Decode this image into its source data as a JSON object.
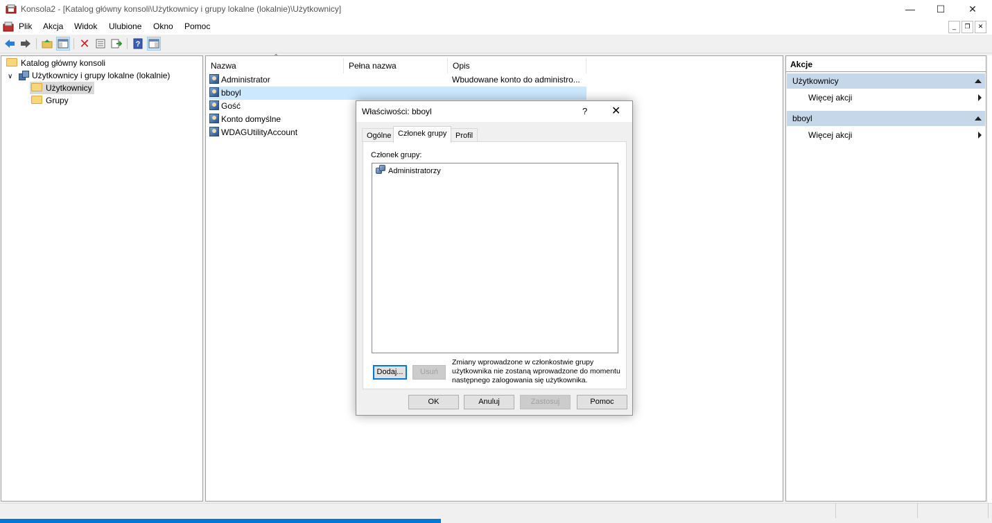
{
  "window": {
    "title": "Konsola2 - [Katalog główny konsoli\\Użytkownicy i grupy lokalne (lokalnie)\\Użytkownicy]"
  },
  "menubar": {
    "items": [
      "Plik",
      "Akcja",
      "Widok",
      "Ulubione",
      "Okno",
      "Pomoc"
    ]
  },
  "toolbar": {
    "icons": [
      "back-arrow-icon",
      "forward-arrow-icon",
      "up-folder-icon",
      "show-hide-console-tree-icon",
      "delete-icon",
      "properties-icon",
      "export-list-icon",
      "help-icon",
      "show-hide-action-pane-icon"
    ]
  },
  "tree": {
    "root": "Katalog główny konsoli",
    "node": "Użytkownicy i grupy lokalne (lokalnie)",
    "children": [
      "Użytkownicy",
      "Grupy"
    ],
    "selected": "Użytkownicy"
  },
  "list": {
    "columns": [
      "Nazwa",
      "Pełna nazwa",
      "Opis"
    ],
    "rows": [
      {
        "name": "Administrator",
        "full_name": "",
        "description": "Wbudowane konto do administro..."
      },
      {
        "name": "bboyl",
        "full_name": "",
        "description": ""
      },
      {
        "name": "Gość",
        "full_name": "",
        "description": ""
      },
      {
        "name": "Konto domyślne",
        "full_name": "",
        "description": ""
      },
      {
        "name": "WDAGUtilityAccount",
        "full_name": "",
        "description": ""
      }
    ],
    "selected_row": "bboyl"
  },
  "actions": {
    "title": "Akcje",
    "sections": [
      {
        "header": "Użytkownicy",
        "item": "Więcej akcji"
      },
      {
        "header": "bboyl",
        "item": "Więcej akcji"
      }
    ]
  },
  "dialog": {
    "title": "Właściwości: bboyl",
    "help_glyph": "?",
    "tabs": [
      "Ogólne",
      "Członek grupy",
      "Profil"
    ],
    "active_tab": "Członek grupy",
    "member_label": "Członek grupy:",
    "members": [
      "Administratorzy"
    ],
    "add_button": "Dodaj...",
    "remove_button": "Usuń",
    "note": "Zmiany wprowadzone w członkostwie grupy użytkownika nie zostaną wprowadzone do momentu następnego zalogowania się użytkownika.",
    "ok_button": "OK",
    "cancel_button": "Anuluj",
    "apply_button": "Zastosuj",
    "help_button": "Pomoc"
  },
  "colors": {
    "selection": "#cce8ff",
    "tree_selection": "#d9d9d9",
    "action_section": "#c7d7ea",
    "taskbar_accent": "#0078d7"
  }
}
